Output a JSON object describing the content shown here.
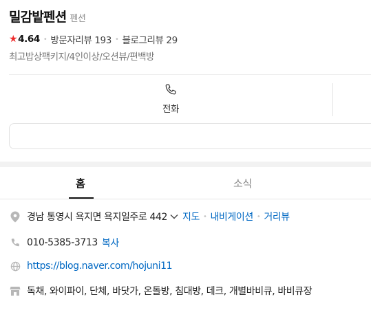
{
  "place": {
    "name": "밀감밭펜션",
    "category": "펜션"
  },
  "rating": {
    "star": "★",
    "score": "4.64",
    "visitor_reviews": "방문자리뷰 193",
    "blog_reviews": "블로그리뷰 29"
  },
  "tags": "최고밥상팩키지/4인이상/오션뷰/편백방",
  "actions": {
    "call_label": "전화"
  },
  "tabs": {
    "home": "홈",
    "news": "소식"
  },
  "info": {
    "address": "경남 통영시 욕지면 욕지일주로 442",
    "map": "지도",
    "navigation": "내비게이션",
    "streetview": "거리뷰",
    "phone": "010-5385-3713",
    "copy": "복사",
    "website": "https://blog.naver.com/hojuni11",
    "amenities": "독채, 와이파이, 단체, 바닷가, 온돌방, 침대방, 데크, 개별바비큐, 바비큐장"
  },
  "colors": {
    "star": "#ee2b2b",
    "link": "#0068c3",
    "icon": "#b7b7b7"
  }
}
